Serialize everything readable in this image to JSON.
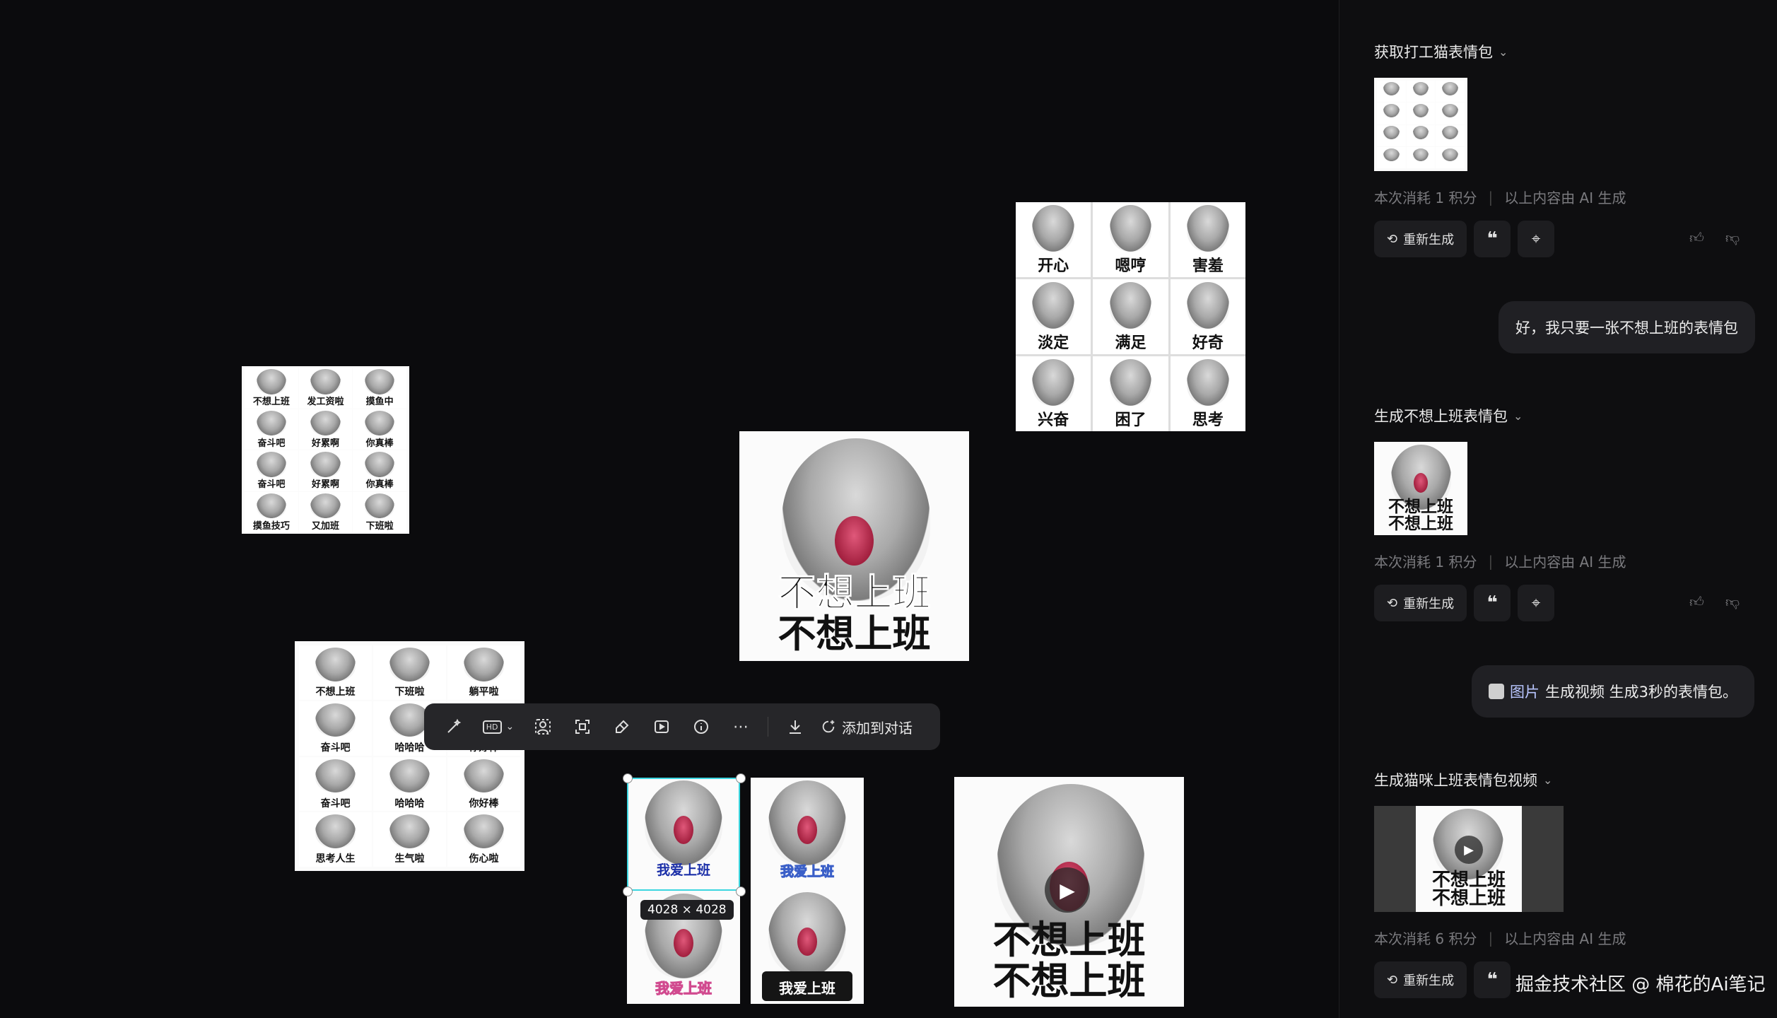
{
  "canvas": {
    "small_grid": {
      "labels": [
        "不想上班",
        "发工资啦",
        "摸鱼中",
        "奋斗吧",
        "好累啊",
        "你真棒",
        "奋斗吧",
        "好累啊",
        "你真棒",
        "摸鱼技巧",
        "又加班",
        "下班啦"
      ]
    },
    "emotion_grid": {
      "labels": [
        "开心",
        "嗯哼",
        "害羞",
        "淡定",
        "满足",
        "好奇",
        "兴奋",
        "困了",
        "思考"
      ]
    },
    "big_meme": {
      "line1": "不想上班",
      "line2": "不想上班"
    },
    "left_grid": {
      "labels": [
        "不想上班",
        "下班啦",
        "躺平啦",
        "奋斗吧",
        "哈哈哈",
        "你好棒",
        "奋斗吧",
        "哈哈哈",
        "你好棒",
        "思考人生",
        "生气啦",
        "伤心啦"
      ]
    },
    "selected_set": {
      "labels": [
        "我爱上班",
        "我爱上班",
        "我爱上班",
        "我爱上班"
      ],
      "dimension": "4028 × 4028"
    },
    "video_meme": {
      "line1": "不想上班",
      "line2": "不想上班"
    }
  },
  "toolbar": {
    "icons": [
      "magic-wand-icon",
      "hd-icon",
      "portrait-icon",
      "expand-icon",
      "eraser-icon",
      "video-icon",
      "info-icon",
      "more-icon",
      "download-icon"
    ],
    "hd_label": "HD",
    "add_to_chat": "添加到对话"
  },
  "panel": {
    "sections": [
      {
        "title": "获取打工猫表情包",
        "meta_cost": "本次消耗 1 积分",
        "meta_ai": "以上内容由 AI 生成",
        "regen": "重新生成"
      },
      {
        "title": "生成不想上班表情包",
        "meta_cost": "本次消耗 1 积分",
        "meta_ai": "以上内容由 AI 生成",
        "regen": "重新生成",
        "thumb_line1": "不想上班",
        "thumb_line2": "不想上班"
      },
      {
        "title": "生成猫咪上班表情包视频",
        "meta_cost": "本次消耗 6 积分",
        "meta_ai": "以上内容由 AI 生成",
        "regen": "重新生成",
        "thumb_line1": "不想上班",
        "thumb_line2": "不想上班"
      }
    ],
    "user_msg_1": "好，我只要一张不想上班的表情包",
    "user_msg_2_ref": "图片",
    "user_msg_2_text": "生成视频 生成3秒的表情包。"
  },
  "watermark": "掘金技术社区 @ 棉花的Ai笔记",
  "colors": {
    "selection": "#3cd6e0",
    "background": "#0b0b0d",
    "panel": "#0e0e10"
  }
}
